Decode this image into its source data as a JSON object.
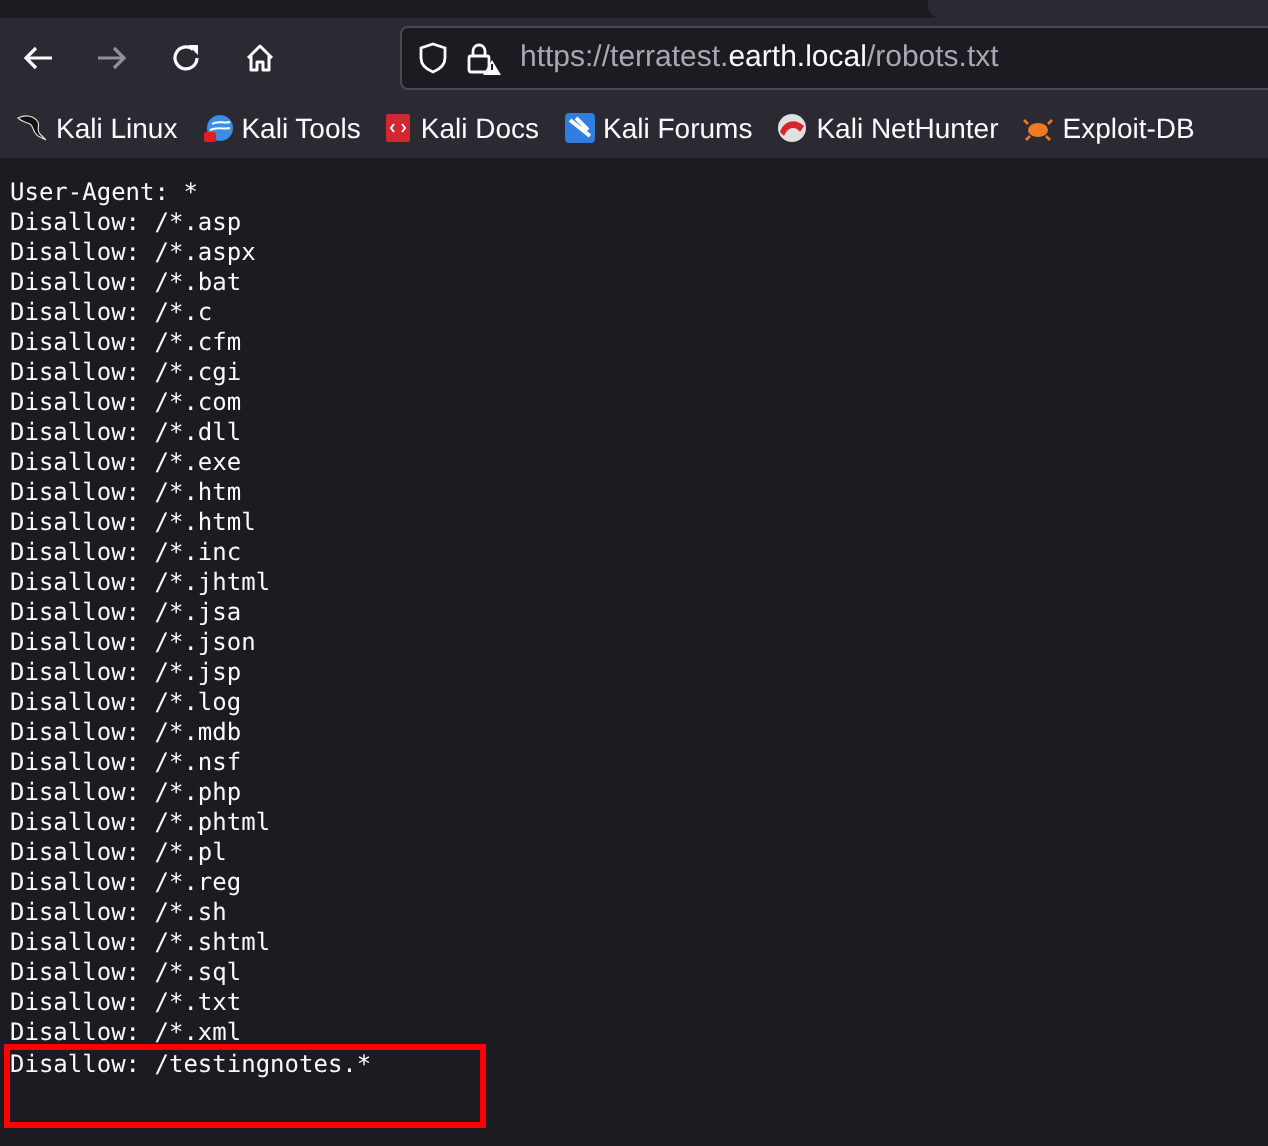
{
  "toolbar": {
    "back": {
      "disabled": false
    },
    "forward": {
      "disabled": true
    }
  },
  "address_bar": {
    "url_parts": [
      {
        "text": "https://terratest.",
        "emphasis": false
      },
      {
        "text": "earth.local",
        "emphasis": true
      },
      {
        "text": "/robots.txt",
        "emphasis": false
      }
    ]
  },
  "bookmarks": [
    {
      "label": "Kali Linux"
    },
    {
      "label": "Kali Tools"
    },
    {
      "label": "Kali Docs"
    },
    {
      "label": "Kali Forums"
    },
    {
      "label": "Kali NetHunter"
    },
    {
      "label": "Exploit-DB"
    }
  ],
  "content": {
    "lines": [
      {
        "text": "User-Agent: *",
        "highlighted": false
      },
      {
        "text": "Disallow: /*.asp",
        "highlighted": false
      },
      {
        "text": "Disallow: /*.aspx",
        "highlighted": false
      },
      {
        "text": "Disallow: /*.bat",
        "highlighted": false
      },
      {
        "text": "Disallow: /*.c",
        "highlighted": false
      },
      {
        "text": "Disallow: /*.cfm",
        "highlighted": false
      },
      {
        "text": "Disallow: /*.cgi",
        "highlighted": false
      },
      {
        "text": "Disallow: /*.com",
        "highlighted": false
      },
      {
        "text": "Disallow: /*.dll",
        "highlighted": false
      },
      {
        "text": "Disallow: /*.exe",
        "highlighted": false
      },
      {
        "text": "Disallow: /*.htm",
        "highlighted": false
      },
      {
        "text": "Disallow: /*.html",
        "highlighted": false
      },
      {
        "text": "Disallow: /*.inc",
        "highlighted": false
      },
      {
        "text": "Disallow: /*.jhtml",
        "highlighted": false
      },
      {
        "text": "Disallow: /*.jsa",
        "highlighted": false
      },
      {
        "text": "Disallow: /*.json",
        "highlighted": false
      },
      {
        "text": "Disallow: /*.jsp",
        "highlighted": false
      },
      {
        "text": "Disallow: /*.log",
        "highlighted": false
      },
      {
        "text": "Disallow: /*.mdb",
        "highlighted": false
      },
      {
        "text": "Disallow: /*.nsf",
        "highlighted": false
      },
      {
        "text": "Disallow: /*.php",
        "highlighted": false
      },
      {
        "text": "Disallow: /*.phtml",
        "highlighted": false
      },
      {
        "text": "Disallow: /*.pl",
        "highlighted": false
      },
      {
        "text": "Disallow: /*.reg",
        "highlighted": false
      },
      {
        "text": "Disallow: /*.sh",
        "highlighted": false
      },
      {
        "text": "Disallow: /*.shtml",
        "highlighted": false
      },
      {
        "text": "Disallow: /*.sql",
        "highlighted": false
      },
      {
        "text": "Disallow: /*.txt",
        "highlighted": false
      },
      {
        "text": "Disallow: /*.xml",
        "highlighted": false
      },
      {
        "text": "Disallow: /testingnotes.*",
        "highlighted": true
      }
    ]
  }
}
